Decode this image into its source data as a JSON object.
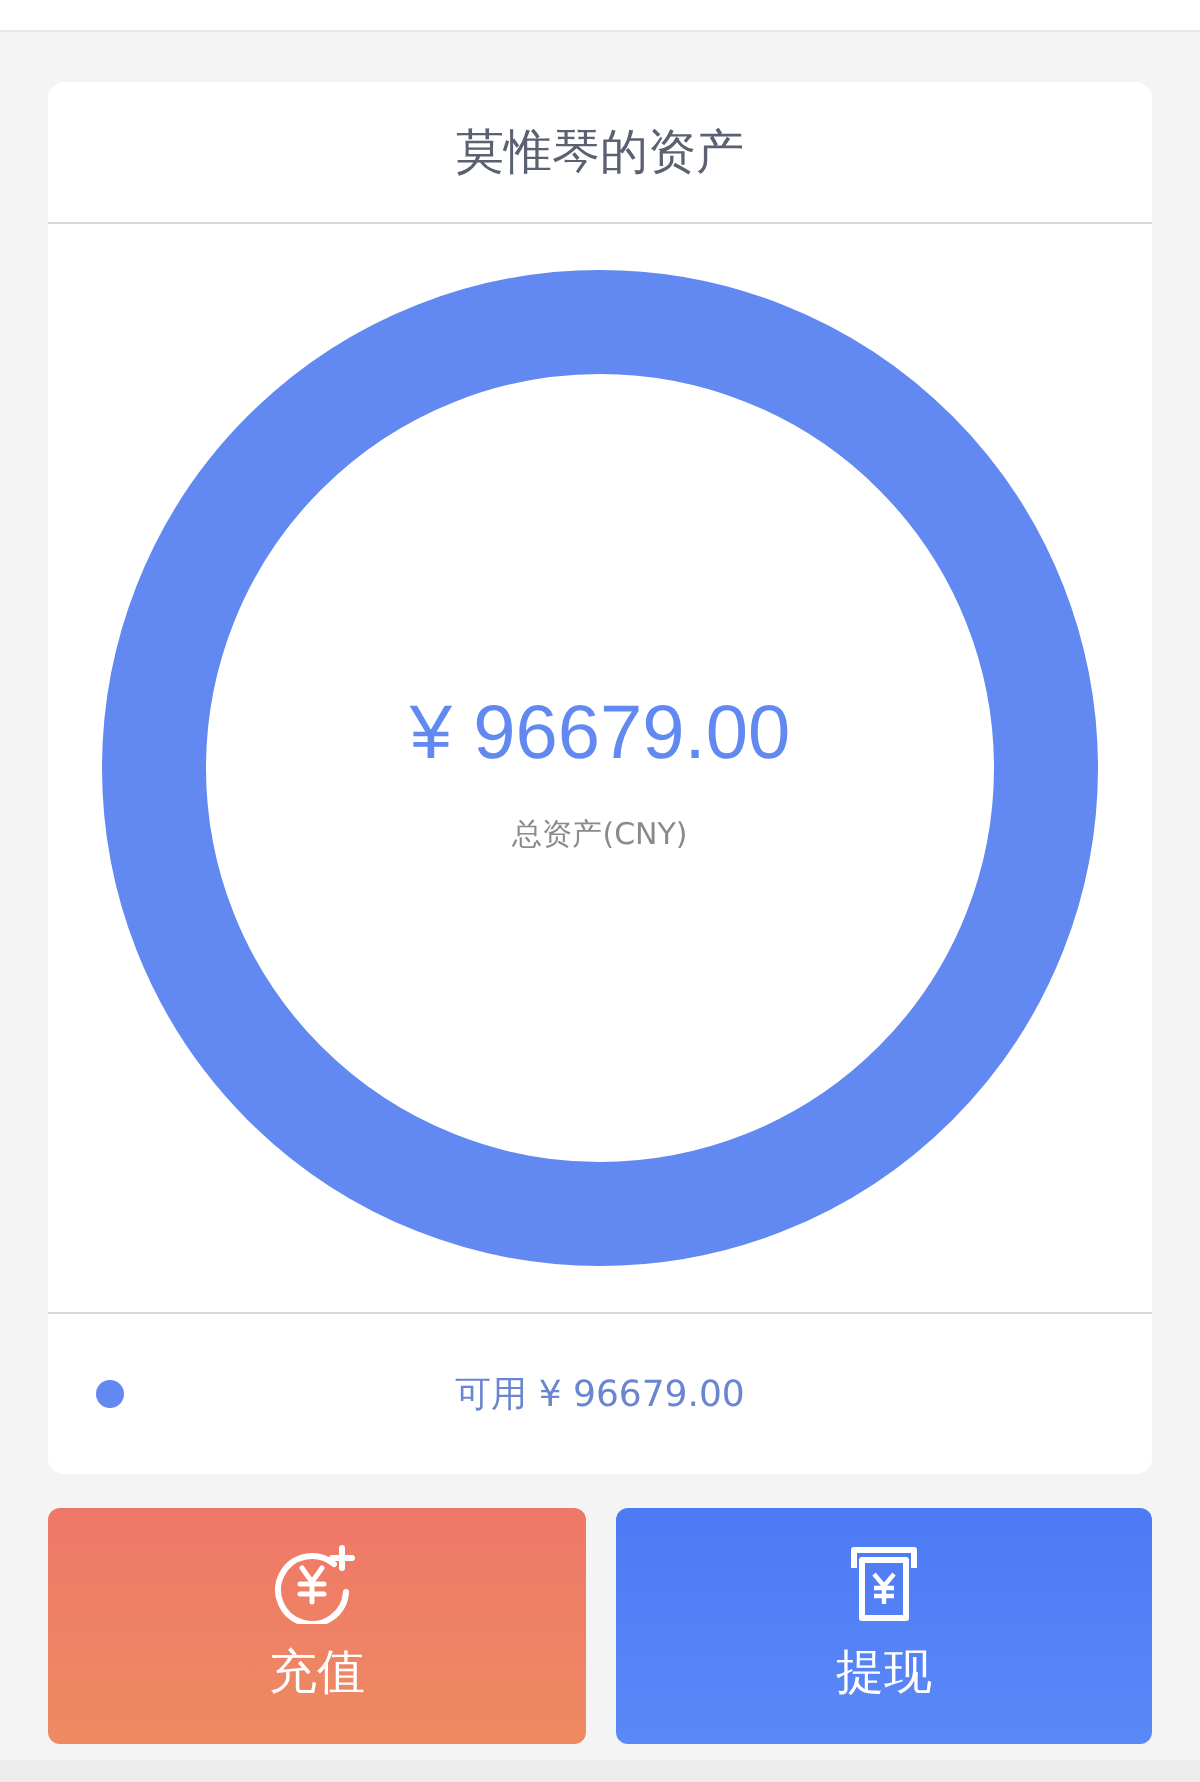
{
  "card": {
    "title": "莫惟琴的资产",
    "total_amount": "¥ 96679.00",
    "total_label": "总资产(CNY)",
    "legend": [
      {
        "label": "可用 ¥ 96679.00",
        "color": "#6289f2"
      }
    ]
  },
  "buttons": [
    {
      "label": "充值",
      "kind": "recharge"
    },
    {
      "label": "提现",
      "kind": "withdraw"
    }
  ]
}
